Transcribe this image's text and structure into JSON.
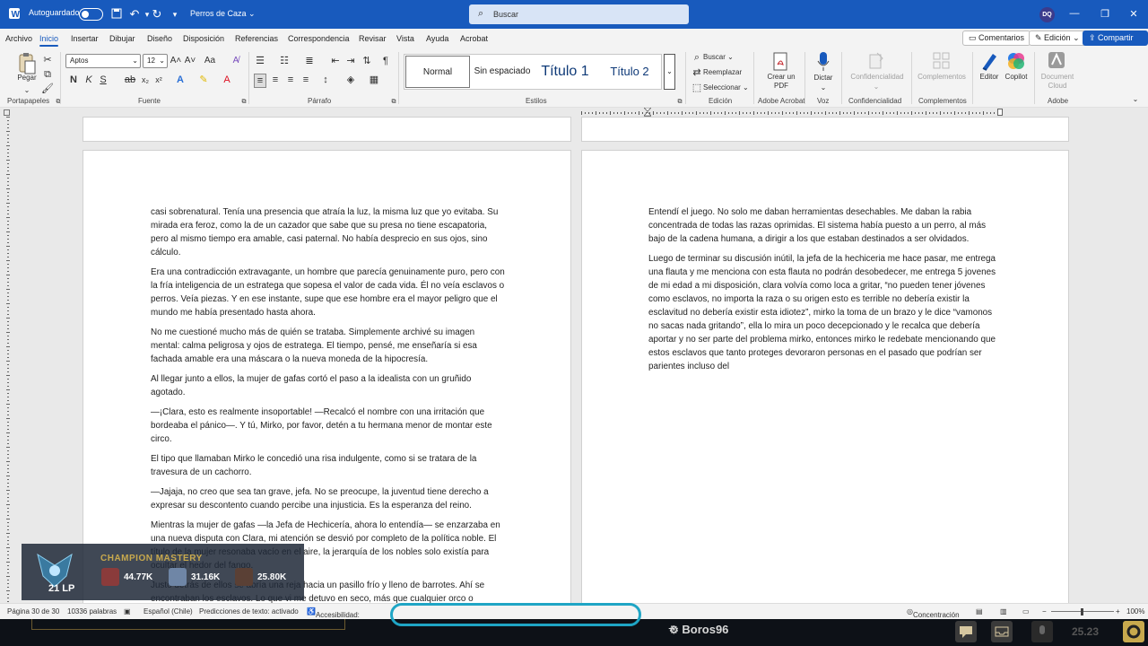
{
  "titlebar": {
    "autosave_label": "Autoguardado",
    "doc_title": "Perros de Caza",
    "search_placeholder": "Buscar",
    "user_initials": "DQ"
  },
  "menu": {
    "tabs": [
      "Archivo",
      "Inicio",
      "Insertar",
      "Dibujar",
      "Diseño",
      "Disposición",
      "Referencias",
      "Correspondencia",
      "Revisar",
      "Vista",
      "Ayuda",
      "Acrobat"
    ],
    "active_tab": "Inicio",
    "comments_label": "Comentarios",
    "editing_label": "Edición",
    "share_label": "Compartir"
  },
  "ribbon": {
    "paste_label": "Pegar",
    "clipboard_label": "Portapapeles",
    "font_name": "Aptos",
    "font_size": "12",
    "font_group_label": "Fuente",
    "paragraph_group_label": "Párrafo",
    "styles_group_label": "Estilos",
    "styles": [
      "Normal",
      "Sin espaciado",
      "Título 1",
      "Título 2"
    ],
    "find_label": "Buscar",
    "replace_label": "Reemplazar",
    "select_label": "Seleccionar",
    "editing_group_label": "Edición",
    "create_pdf_label": "Crear un PDF",
    "acrobat_group_label": "Adobe Acrobat",
    "dictate_label": "Dictar",
    "voice_group_label": "Voz",
    "confidentiality_label": "Confidencialidad",
    "confidentiality_group_label": "Confidencialidad",
    "addins_label": "Complementos",
    "addins_group_label": "Complementos",
    "editor_label": "Editor",
    "copilot_label": "Copilot",
    "document_cloud_label": "Document Cloud",
    "adobe_group_label": "Adobe"
  },
  "left_page": {
    "paragraphs": [
      "casi sobrenatural. Tenía una presencia que atraía la luz, la misma luz que yo evitaba. Su mirada era feroz, como la de un cazador que sabe que su presa no tiene escapatoria, pero al mismo tiempo era amable, casi paternal. No había desprecio en sus ojos, sino cálculo.",
      "Era una contradicción extravagante, un hombre que parecía genuinamente puro, pero con la fría inteligencia de un estratega que sopesa el valor de cada vida. Él no veía esclavos o perros. Veía piezas. Y en ese instante, supe que ese hombre era el mayor peligro que el mundo me había presentado hasta ahora.",
      "No me cuestioné mucho más de quién se trataba. Simplemente archivé su imagen mental: calma peligrosa y ojos de estratega. El tiempo, pensé, me enseñaría si esa fachada amable era una máscara o la nueva moneda de la hipocresía.",
      "Al llegar junto a ellos, la mujer de gafas cortó el paso a la idealista con un gruñido agotado.",
      "—¡Clara, esto es realmente insoportable! —Recalcó el nombre con una irritación que bordeaba el pánico—. Y tú, Mirko, por favor, detén a tu hermana menor de montar este circo.",
      "El tipo que llamaban Mirko le concedió una risa indulgente, como si se tratara de la travesura de un cachorro.",
      "—Jajaja, no creo que sea tan grave, jefa. No se preocupe, la juventud tiene derecho a expresar su descontento cuando percibe una injusticia. Es la esperanza del reino.",
      "Mientras la mujer de gafas —la Jefa de Hechicería, ahora lo entendía— se enzarzaba en una nueva disputa con Clara, mi atención se desvió por completo de la política noble. El título de la mujer resonaba vacío en el aire, la jerarquía de los nobles solo existía para ocultar el hedor del fango.",
      "Justo detrás de ellos se abría una reja hacia un pasillo frío y lleno de barrotes. Ahí se encontraban los esclavos. Lo que vi me detuvo en seco, más que cualquier orco o"
    ]
  },
  "right_page": {
    "paragraphs": [
      "Entendí el juego. No solo me daban herramientas desechables. Me daban la rabia concentrada de todas las razas oprimidas. El sistema había puesto a un perro, al más bajo de la cadena humana, a dirigir a los que estaban destinados a ser olvidados.",
      "Luego de terminar su discusión inútil, la jefa de la hechiceria me hace pasar, me entrega una flauta y me menciona con esta flauta no podrán desobedecer, me entrega 5 jovenes de mi edad a mi disposición, clara volvía como loca a gritar, “no pueden tener jóvenes como esclavos, no importa la raza o su origen esto es terrible no debería existir la esclavitud no debería existir esta idiotez”, mirko la toma de un brazo y le dice “vamonos no sacas nada gritando”, ella lo mira un poco decepcionado y le recalca que debería aportar y no ser parte del problema mirko, entonces mirko le redebate mencionando que estos esclavos que tanto proteges devoraron personas en el pasado que podrían ser parientes incluso del"
    ]
  },
  "overlay": {
    "mastery_label": "CHAMPION MASTERY",
    "lp": "21 LP",
    "scores": [
      "44.77K",
      "31.16K",
      "25.80K"
    ]
  },
  "status": {
    "page": "Página 30 de 30",
    "words": "10336 palabras",
    "language": "Español (Chile)",
    "predictions": "Predicciones de texto: activado",
    "accessibility": "Accesibilidad: todo correcto",
    "focus": "Concentración",
    "zoom": "100%"
  },
  "taskbar": {
    "player_name": "Boros96",
    "clock": "25.23"
  }
}
